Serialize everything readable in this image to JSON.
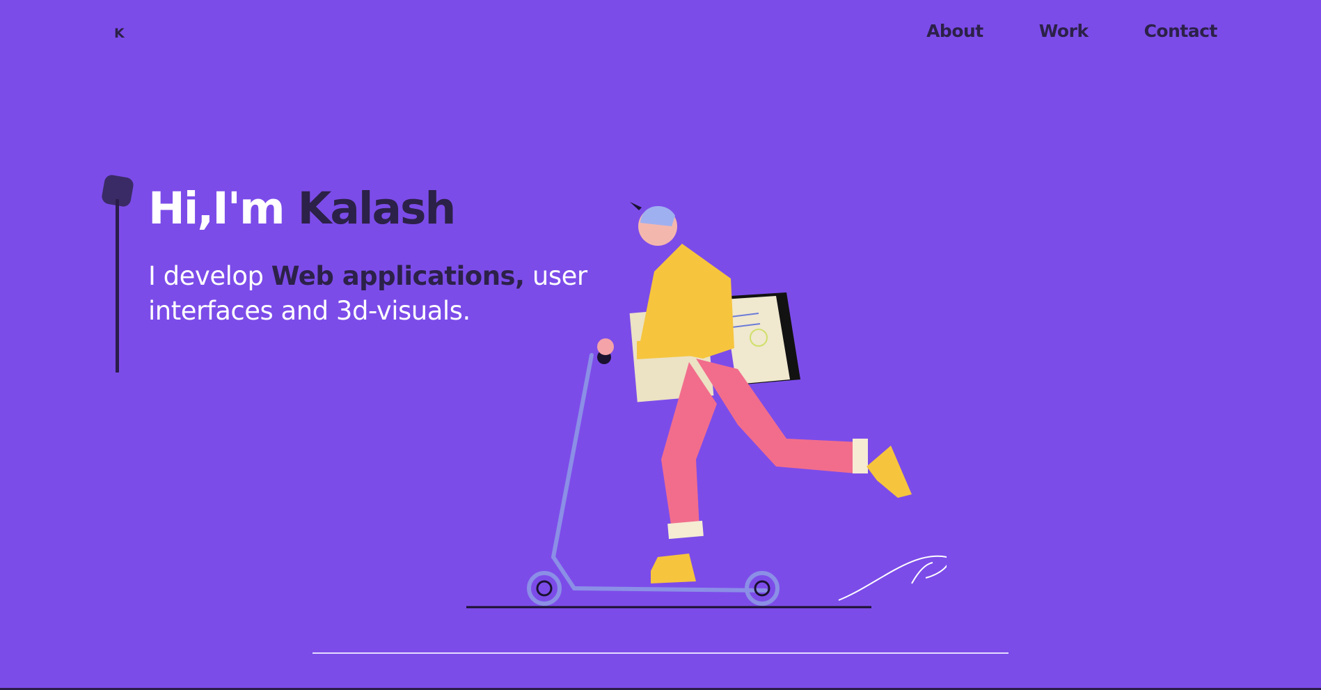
{
  "logo": "K",
  "nav": {
    "items": [
      "About",
      "Work",
      "Contact"
    ]
  },
  "hero": {
    "greeting": "Hi,I'm",
    "name": "Kalash",
    "sub_prefix": "I develop ",
    "sub_accent": "Web applications,",
    "sub_rest": " user interfaces and 3d-visuals."
  },
  "illustration": {
    "icon": "person-on-scooter-illustration"
  },
  "colors": {
    "background": "#7c4ce9",
    "dark_text": "#2c2148",
    "light_text": "#ffffff"
  }
}
